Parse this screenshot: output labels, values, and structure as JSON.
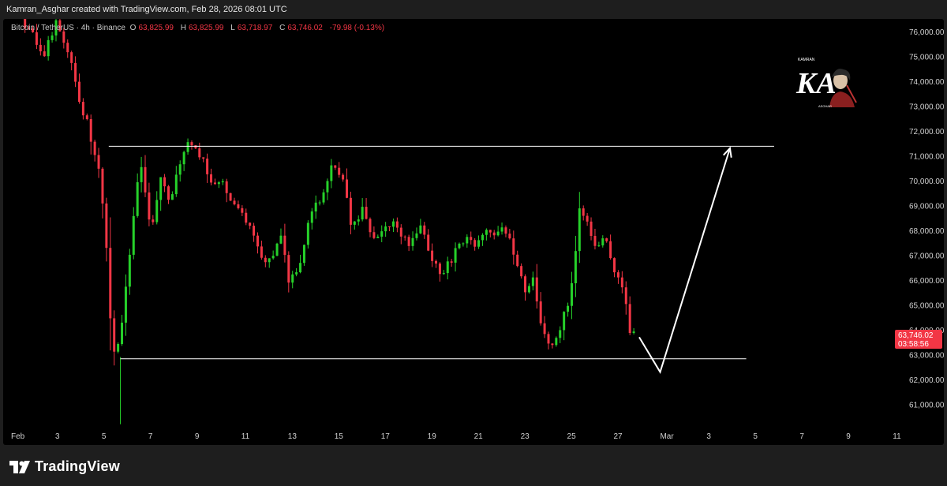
{
  "header": {
    "attribution": "Kamran_Asghar created with TradingView.com, Feb 28, 2026 08:01 UTC"
  },
  "legend": {
    "symbol": "Bitcoin / TetherUS · 4h · Binance",
    "open_label": "O",
    "open": "63,825.99",
    "high_label": "H",
    "high": "63,825.99",
    "low_label": "L",
    "low": "63,718.97",
    "close_label": "C",
    "close": "63,746.02",
    "change": "-79.98 (-0.13%)"
  },
  "watermark": {
    "top_text": "KAMRAN",
    "initials": "KA",
    "bottom_text": "ASGHAR"
  },
  "price_tag": {
    "price": "63,746.02",
    "countdown": "03:58:56",
    "color": "#f23645"
  },
  "footer": {
    "brand": "TradingView"
  },
  "colors": {
    "up": "#26d12a",
    "down": "#f23645",
    "axis_text": "#d0d0d0",
    "annotation": "#ffffff"
  },
  "chart_data": {
    "type": "candlestick",
    "interval": "4h",
    "symbol": "Bitcoin / TetherUS",
    "exchange": "Binance",
    "ylim": [
      60000,
      76500
    ],
    "y_ticks": [
      61000,
      62000,
      63000,
      64000,
      65000,
      66000,
      67000,
      68000,
      69000,
      70000,
      71000,
      72000,
      73000,
      74000,
      75000,
      76000
    ],
    "y_tick_labels": [
      "61,000.00",
      "62,000.00",
      "63,000.00",
      "64,000.00",
      "65,000.00",
      "66,000.00",
      "67,000.00",
      "68,000.00",
      "69,000.00",
      "70,000.00",
      "71,000.00",
      "72,000.00",
      "73,000.00",
      "74,000.00",
      "75,000.00",
      "76,000.00"
    ],
    "x_range_days": [
      0,
      38.5
    ],
    "x_ticks": [
      {
        "day": 0,
        "label": "Feb"
      },
      {
        "day": 2,
        "label": "3"
      },
      {
        "day": 4,
        "label": "5"
      },
      {
        "day": 6,
        "label": "7"
      },
      {
        "day": 8,
        "label": "9"
      },
      {
        "day": 10,
        "label": "11"
      },
      {
        "day": 12,
        "label": "13"
      },
      {
        "day": 14,
        "label": "15"
      },
      {
        "day": 16,
        "label": "17"
      },
      {
        "day": 18,
        "label": "19"
      },
      {
        "day": 20,
        "label": "21"
      },
      {
        "day": 22,
        "label": "23"
      },
      {
        "day": 24,
        "label": "25"
      },
      {
        "day": 26,
        "label": "27"
      },
      {
        "day": 28,
        "label": "Mar"
      },
      {
        "day": 30,
        "label": "3"
      },
      {
        "day": 32,
        "label": "5"
      },
      {
        "day": 34,
        "label": "7"
      },
      {
        "day": 36,
        "label": "9"
      },
      {
        "day": 38,
        "label": "11"
      }
    ],
    "price_path": [
      [
        0.6,
        76500
      ],
      [
        1.1,
        75800
      ],
      [
        1.6,
        75200
      ],
      [
        2.1,
        76400
      ],
      [
        2.7,
        74800
      ],
      [
        3.0,
        73600
      ],
      [
        3.4,
        72400
      ],
      [
        3.9,
        70700
      ],
      [
        4.2,
        68200
      ],
      [
        4.45,
        64400
      ],
      [
        4.65,
        62900
      ],
      [
        4.95,
        64500
      ],
      [
        5.3,
        67100
      ],
      [
        5.7,
        71000
      ],
      [
        6.2,
        68000
      ],
      [
        6.6,
        70000
      ],
      [
        7.0,
        69200
      ],
      [
        7.4,
        70800
      ],
      [
        7.8,
        71400
      ],
      [
        8.3,
        71100
      ],
      [
        8.8,
        70000
      ],
      [
        9.3,
        69800
      ],
      [
        9.8,
        68800
      ],
      [
        10.3,
        68400
      ],
      [
        10.8,
        67200
      ],
      [
        11.3,
        66700
      ],
      [
        11.8,
        67800
      ],
      [
        12.1,
        65800
      ],
      [
        12.6,
        66800
      ],
      [
        13.0,
        68600
      ],
      [
        13.5,
        69200
      ],
      [
        14.0,
        70600
      ],
      [
        14.5,
        69800
      ],
      [
        14.8,
        68200
      ],
      [
        15.3,
        68900
      ],
      [
        15.8,
        67600
      ],
      [
        16.3,
        68400
      ],
      [
        16.8,
        68000
      ],
      [
        17.3,
        67400
      ],
      [
        17.8,
        68400
      ],
      [
        18.2,
        66900
      ],
      [
        18.7,
        66200
      ],
      [
        19.2,
        67000
      ],
      [
        19.7,
        67600
      ],
      [
        20.1,
        67300
      ],
      [
        20.6,
        67900
      ],
      [
        21.1,
        68000
      ],
      [
        21.5,
        67800
      ],
      [
        22.0,
        66500
      ],
      [
        22.3,
        65400
      ],
      [
        22.6,
        65900
      ],
      [
        23.0,
        63800
      ],
      [
        23.5,
        63400
      ],
      [
        24.0,
        64700
      ],
      [
        24.3,
        66100
      ],
      [
        24.6,
        68900
      ],
      [
        25.0,
        68100
      ],
      [
        25.4,
        67300
      ],
      [
        25.8,
        67700
      ],
      [
        26.1,
        66100
      ],
      [
        26.5,
        65700
      ],
      [
        26.8,
        63750
      ]
    ],
    "annotations": [
      {
        "type": "horizontal-line",
        "name": "resistance",
        "y": 71380,
        "x_range": [
          4.2,
          32.8
        ]
      },
      {
        "type": "horizontal-line",
        "name": "support",
        "y": 62830,
        "x_range": [
          4.7,
          31.6
        ]
      },
      {
        "type": "arrow-path",
        "name": "projection",
        "points": [
          [
            27.0,
            63700
          ],
          [
            27.9,
            62300
          ],
          [
            30.9,
            71300
          ]
        ]
      }
    ]
  }
}
